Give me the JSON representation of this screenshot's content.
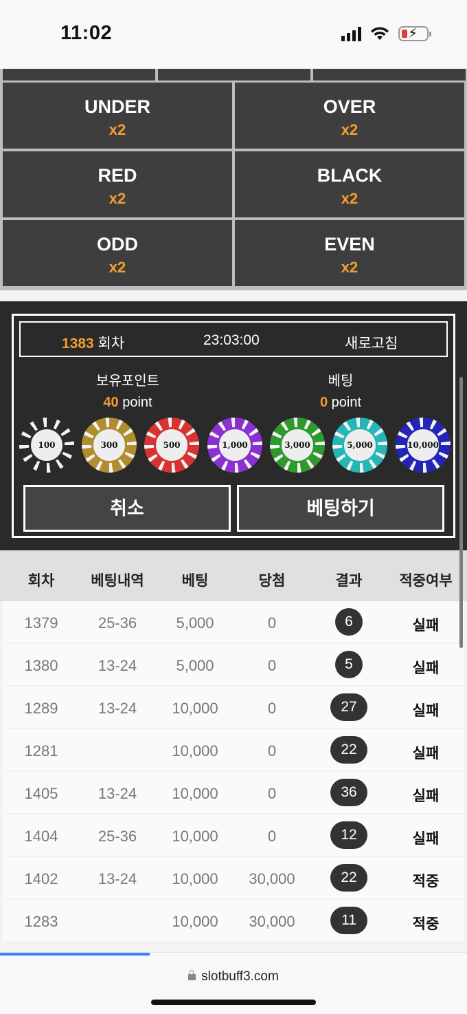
{
  "status_bar": {
    "time": "11:02"
  },
  "bet_options": [
    {
      "label": "UNDER",
      "multiplier": "x2"
    },
    {
      "label": "OVER",
      "multiplier": "x2"
    },
    {
      "label": "RED",
      "multiplier": "x2"
    },
    {
      "label": "BLACK",
      "multiplier": "x2"
    },
    {
      "label": "ODD",
      "multiplier": "x2"
    },
    {
      "label": "EVEN",
      "multiplier": "x2"
    }
  ],
  "panel": {
    "round_number": "1383",
    "round_suffix": " 회차",
    "timer": "23:03:00",
    "refresh_label": "새로고침",
    "held_points_label": "보유포인트",
    "held_points_value": "40",
    "bet_label": "베팅",
    "bet_value": "0",
    "point_unit": " point",
    "chips": [
      {
        "value": "100",
        "color": "#2b2b2b"
      },
      {
        "value": "300",
        "color": "#b08d2e"
      },
      {
        "value": "500",
        "color": "#d93232"
      },
      {
        "value": "1,000",
        "color": "#8a2fd1"
      },
      {
        "value": "3,000",
        "color": "#2e9a2e"
      },
      {
        "value": "5,000",
        "color": "#25b7b7"
      },
      {
        "value": "10,000",
        "color": "#2424b8"
      }
    ],
    "cancel_label": "취소",
    "bet_button_label": "베팅하기"
  },
  "table": {
    "headers": [
      "회차",
      "베팅내역",
      "베팅",
      "당첨",
      "결과",
      "적중여부"
    ],
    "rows": [
      {
        "round": "1379",
        "detail": "25-36",
        "bet": "5,000",
        "win": "0",
        "result": "6",
        "outcome": "실패"
      },
      {
        "round": "1380",
        "detail": "13-24",
        "bet": "5,000",
        "win": "0",
        "result": "5",
        "outcome": "실패"
      },
      {
        "round": "1289",
        "detail": "13-24",
        "bet": "10,000",
        "win": "0",
        "result": "27",
        "outcome": "실패"
      },
      {
        "round": "1281",
        "detail": "",
        "bet": "10,000",
        "win": "0",
        "result": "22",
        "outcome": "실패"
      },
      {
        "round": "1405",
        "detail": "13-24",
        "bet": "10,000",
        "win": "0",
        "result": "36",
        "outcome": "실패"
      },
      {
        "round": "1404",
        "detail": "25-36",
        "bet": "10,000",
        "win": "0",
        "result": "12",
        "outcome": "실패"
      },
      {
        "round": "1402",
        "detail": "13-24",
        "bet": "10,000",
        "win": "30,000",
        "result": "22",
        "outcome": "적중"
      },
      {
        "round": "1283",
        "detail": "",
        "bet": "10,000",
        "win": "30,000",
        "result": "11",
        "outcome": "적중"
      }
    ]
  },
  "browser": {
    "url": "slotbuff3.com",
    "load_progress": 0.32
  },
  "colors": {
    "accent": "#f39c30",
    "panel_bg": "#2a2a2a",
    "cell_bg": "#3e3e3e",
    "progress": "#3b82f6"
  }
}
